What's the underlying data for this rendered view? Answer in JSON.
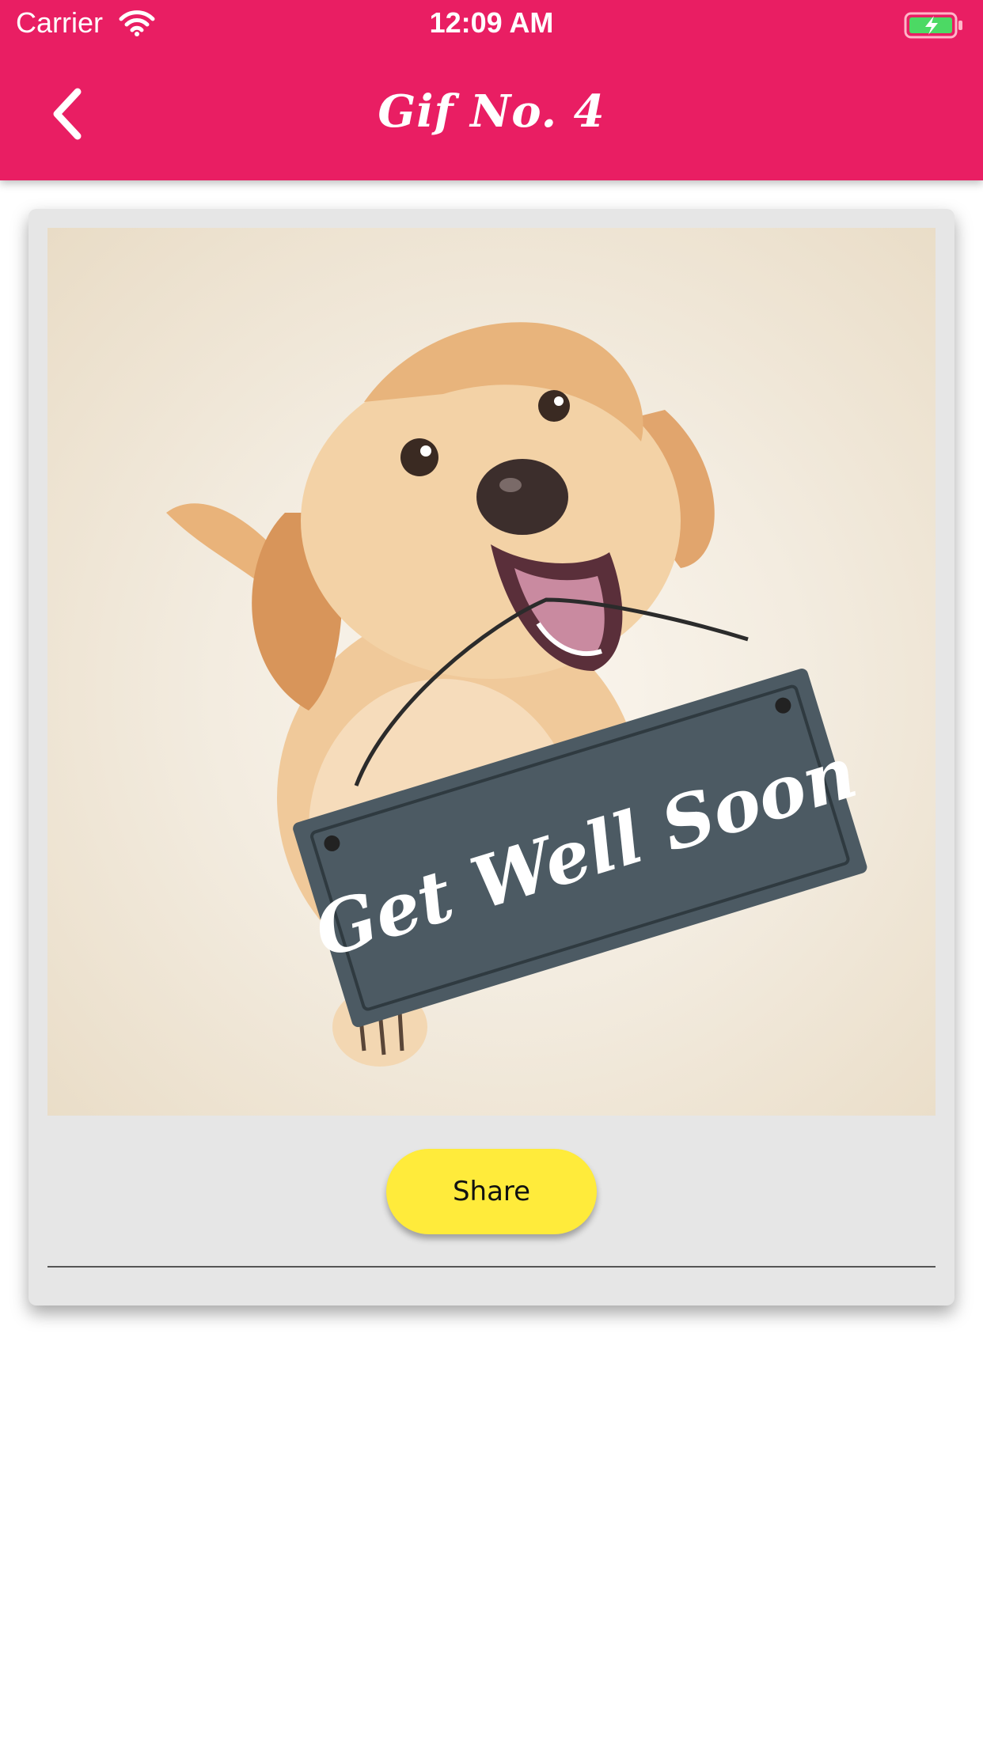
{
  "colors": {
    "accent": "#e91e63",
    "button": "#ffeb3b"
  },
  "status_bar": {
    "carrier": "Carrier",
    "time": "12:09 AM",
    "icons": [
      "wifi-icon",
      "battery-charging-icon"
    ]
  },
  "header": {
    "back_icon": "chevron-left-icon",
    "title": "Gif No. 4"
  },
  "card": {
    "image": {
      "sign_text": "Get Well Soon"
    },
    "share_label": "Share"
  }
}
